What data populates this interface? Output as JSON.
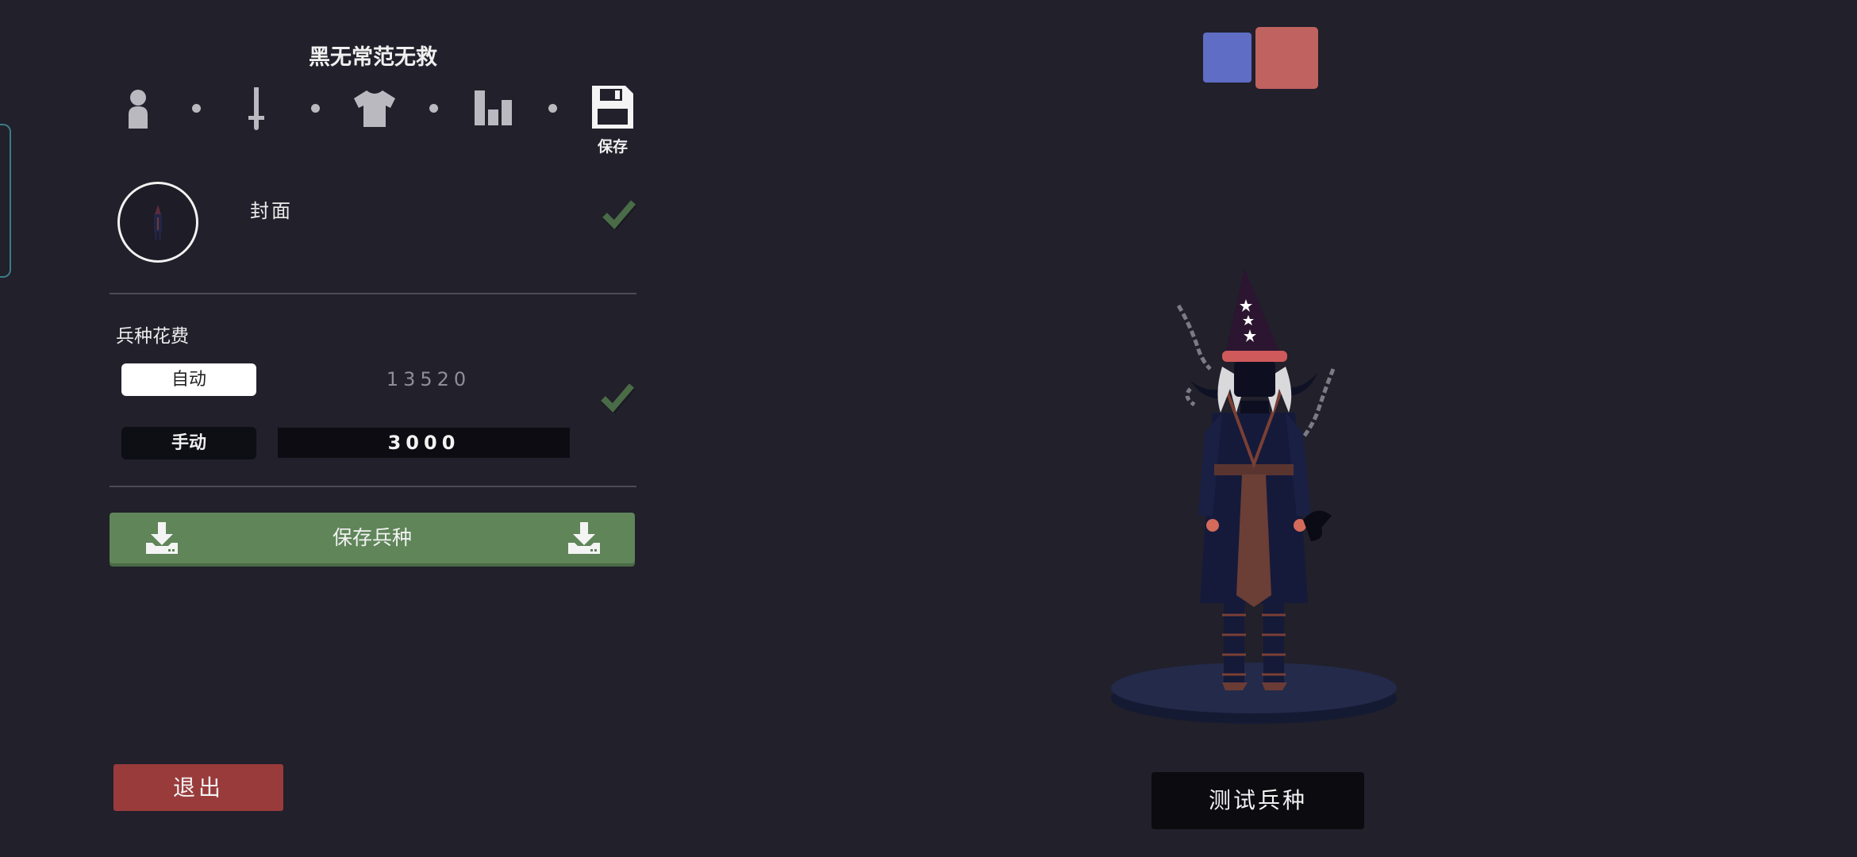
{
  "editor": {
    "unit_name": "黑无常范无救",
    "steps": [
      {
        "icon": "person-icon"
      },
      {
        "icon": "sword-icon"
      },
      {
        "icon": "shirt-icon"
      },
      {
        "icon": "bar-chart-icon"
      },
      {
        "icon": "floppy-disk-icon",
        "label": "保存"
      }
    ],
    "cover": {
      "label": "封面"
    },
    "cost": {
      "title": "兵种花费",
      "auto_label": "自动",
      "auto_value": "13520",
      "manual_label": "手动",
      "manual_value": "3000",
      "selected_mode": "自动"
    },
    "save_unit_label": "保存兵种",
    "exit_label": "退出"
  },
  "preview": {
    "test_label": "测试兵种",
    "teams": [
      {
        "name": "blue",
        "color": "#5f6dc4"
      },
      {
        "name": "red",
        "color": "#c0625f"
      }
    ]
  },
  "colors": {
    "background": "#21202b",
    "save_green": "#5f8559",
    "exit_red": "#9a3b3b",
    "check_green": "#4a6b47"
  }
}
